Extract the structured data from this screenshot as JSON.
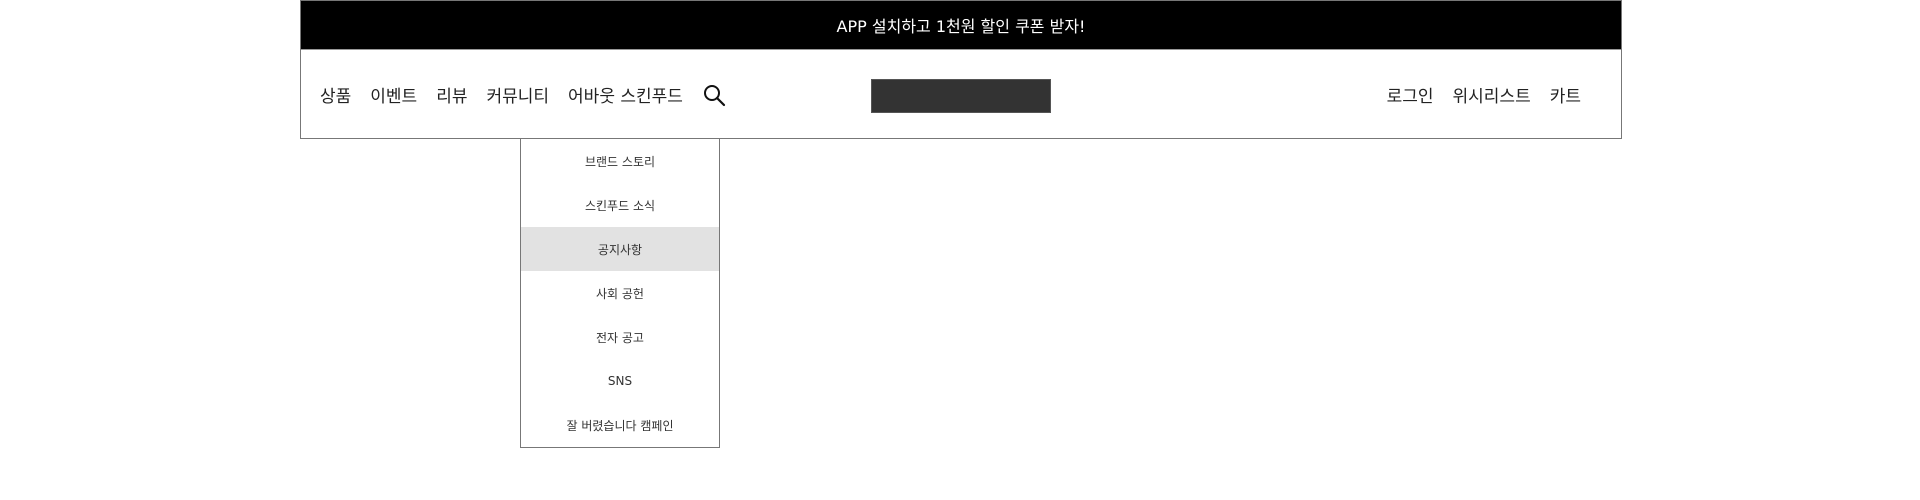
{
  "promo": {
    "text": "APP 설치하고 1천원 할인 쿠폰 받자!"
  },
  "nav": {
    "left_items": [
      {
        "label": "상품"
      },
      {
        "label": "이벤트"
      },
      {
        "label": "리뷰"
      },
      {
        "label": "커뮤니티"
      },
      {
        "label": "어바웃 스킨푸드"
      }
    ],
    "search_icon": "search-icon",
    "right_items": [
      {
        "label": "로그인"
      },
      {
        "label": "위시리스트"
      },
      {
        "label": "카트"
      }
    ]
  },
  "logo": {
    "color": "#333333"
  },
  "dropdown": {
    "items": [
      {
        "label": "브랜드 스토리"
      },
      {
        "label": "스킨푸드 소식"
      },
      {
        "label": "공지사항"
      },
      {
        "label": "사회 공헌"
      },
      {
        "label": "전자 공고"
      },
      {
        "label": "SNS"
      },
      {
        "label": "잘 버렸습니다 캠페인"
      }
    ],
    "active_index": 2
  }
}
